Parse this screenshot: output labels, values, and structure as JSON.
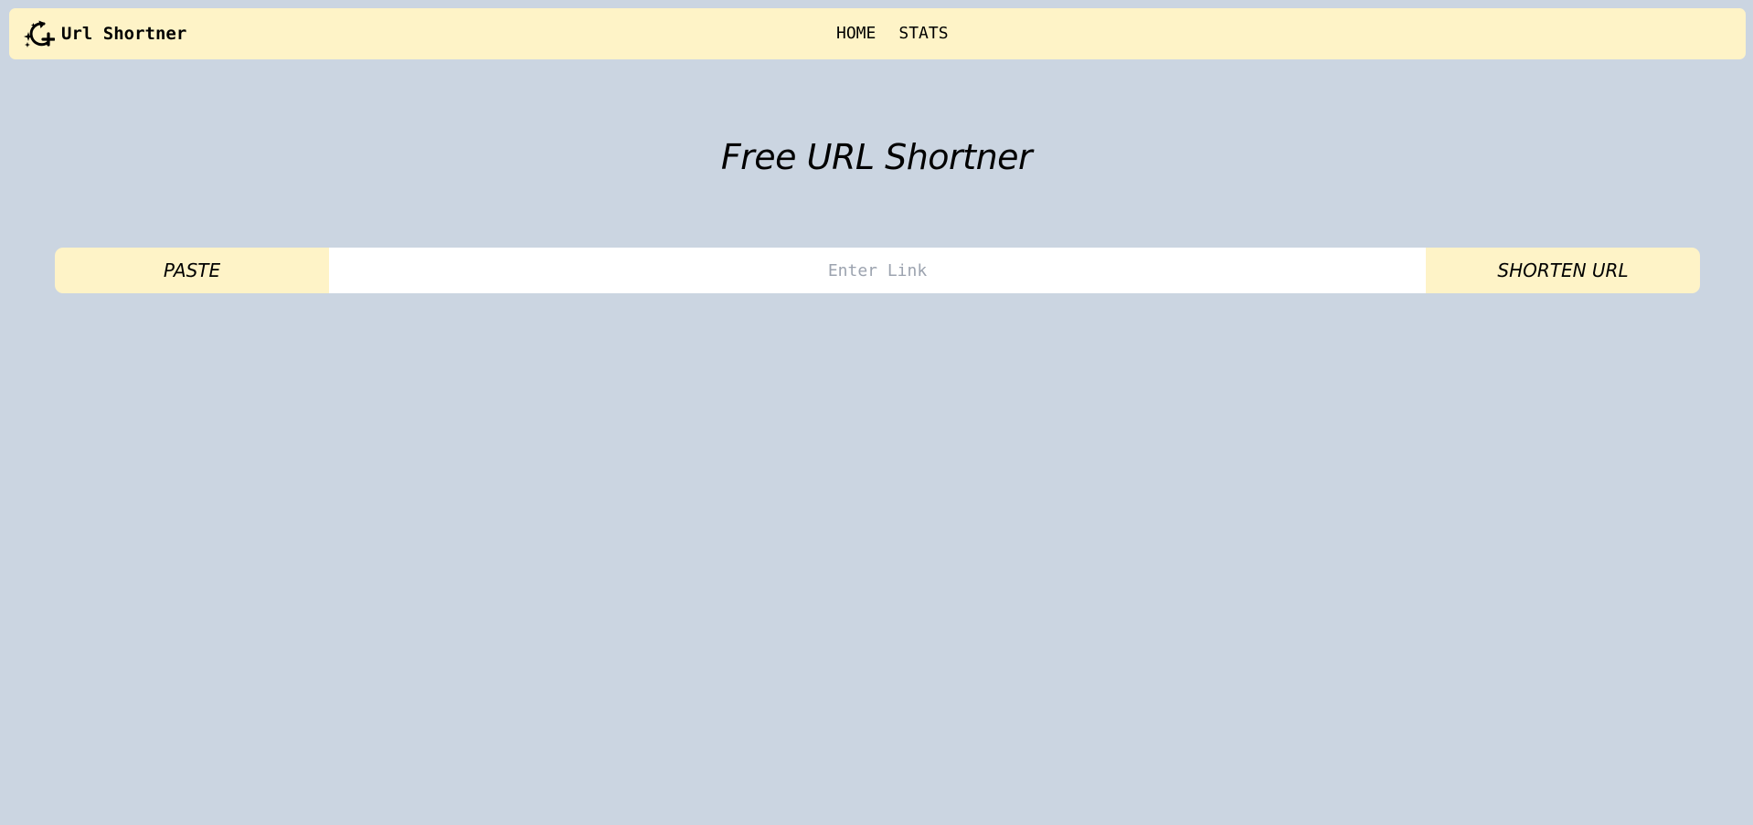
{
  "navbar": {
    "brand_icon": "sparkles-rotate-icon",
    "brand_title": "Url Shortner",
    "links": [
      {
        "label": "HOME"
      },
      {
        "label": "STATS"
      }
    ]
  },
  "main": {
    "title": "Free URL Shortner",
    "paste_label": "PASTE",
    "input_value": "",
    "input_placeholder": "Enter Link",
    "shorten_label": "SHORTEN URL"
  },
  "colors": {
    "page_background": "#cbd5e1",
    "accent": "#fef3c7",
    "input_background": "#ffffff",
    "placeholder_text": "#9ca3af",
    "text": "#000000"
  }
}
